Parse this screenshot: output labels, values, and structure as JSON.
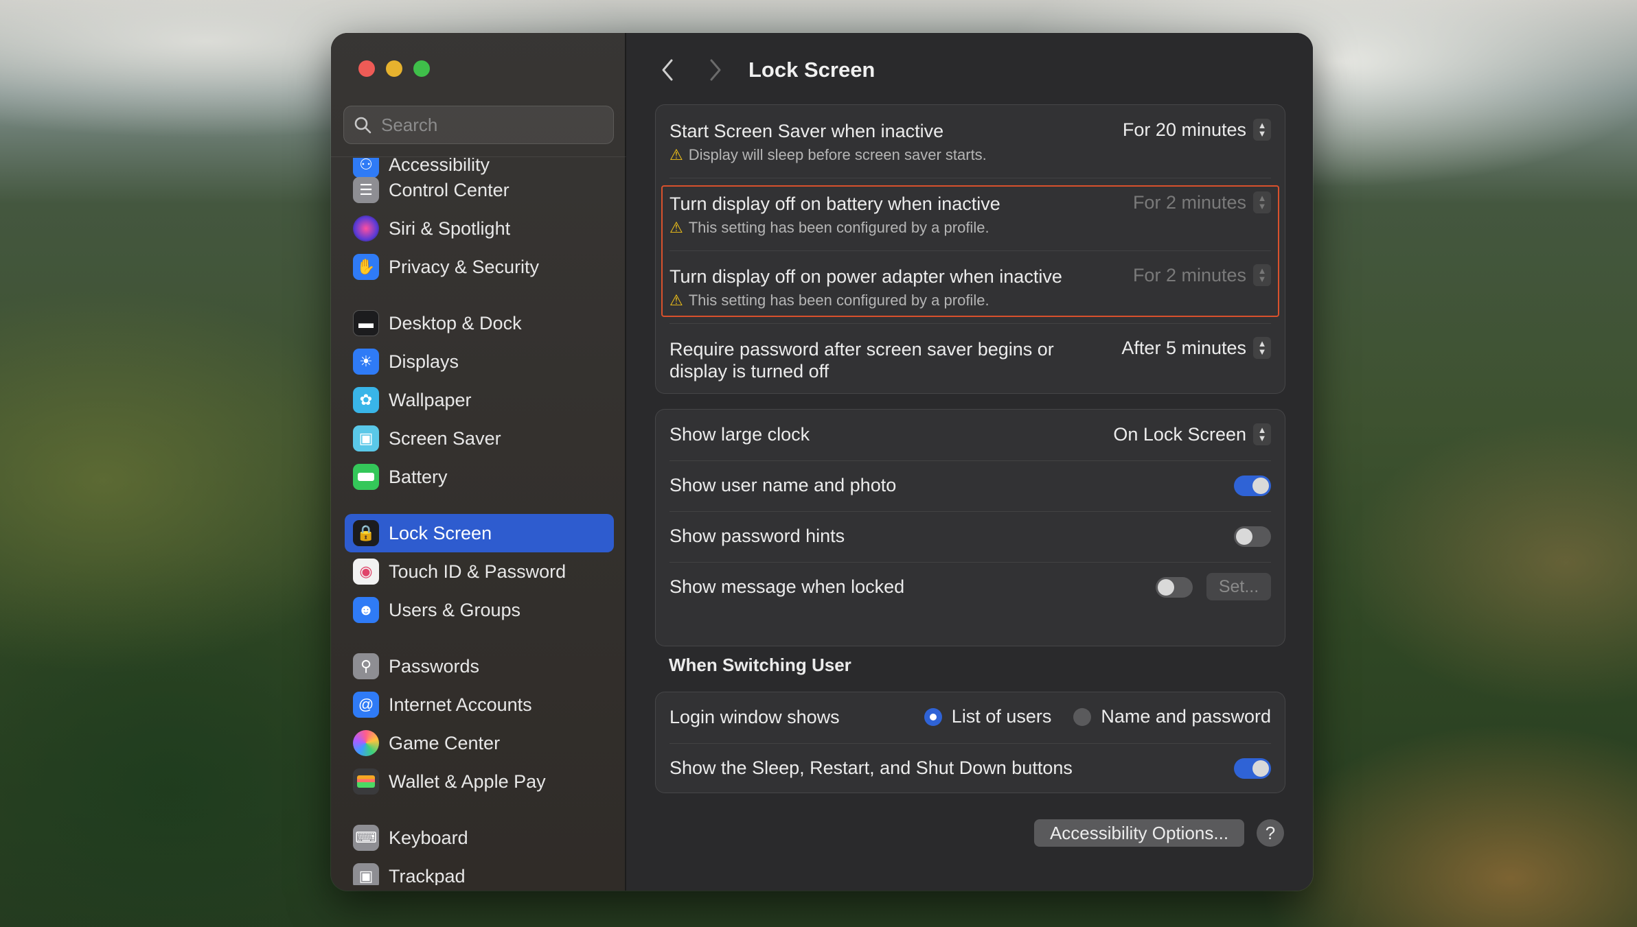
{
  "window": {
    "traffic_lights": [
      "close",
      "minimize",
      "zoom"
    ]
  },
  "sidebar": {
    "search_placeholder": "Search",
    "items": [
      {
        "label": "Accessibility",
        "icon": "accessibility-icon",
        "color": "#2f7bf6"
      },
      {
        "label": "Control Center",
        "icon": "control-center-icon",
        "color": "#8e8e93"
      },
      {
        "label": "Siri & Spotlight",
        "icon": "siri-icon",
        "color": "#7a4bd6"
      },
      {
        "label": "Privacy & Security",
        "icon": "hand-icon",
        "color": "#2f7bf6"
      },
      {
        "label": "Desktop & Dock",
        "icon": "dock-icon",
        "color": "#1c1c1e"
      },
      {
        "label": "Displays",
        "icon": "sun-icon",
        "color": "#2f7bf6"
      },
      {
        "label": "Wallpaper",
        "icon": "flower-icon",
        "color": "#39b5e8"
      },
      {
        "label": "Screen Saver",
        "icon": "screen-saver-icon",
        "color": "#5ac8e8"
      },
      {
        "label": "Battery",
        "icon": "battery-icon",
        "color": "#34c759"
      },
      {
        "label": "Lock Screen",
        "icon": "lock-icon",
        "color": "#1c1c1e"
      },
      {
        "label": "Touch ID & Password",
        "icon": "fingerprint-icon",
        "color": "#f2f2f2"
      },
      {
        "label": "Users & Groups",
        "icon": "users-icon",
        "color": "#2f7bf6"
      },
      {
        "label": "Passwords",
        "icon": "key-icon",
        "color": "#8e8e93"
      },
      {
        "label": "Internet Accounts",
        "icon": "at-icon",
        "color": "#2f7bf6"
      },
      {
        "label": "Game Center",
        "icon": "game-center-icon",
        "color": "#ff6b8a"
      },
      {
        "label": "Wallet & Apple Pay",
        "icon": "wallet-icon",
        "color": "#3a3a3c"
      },
      {
        "label": "Keyboard",
        "icon": "keyboard-icon",
        "color": "#8e8e93"
      },
      {
        "label": "Trackpad",
        "icon": "trackpad-icon",
        "color": "#8e8e93"
      }
    ],
    "selected": "Lock Screen"
  },
  "header": {
    "back_icon": "chevron-left-icon",
    "forward_icon": "chevron-right-icon",
    "title": "Lock Screen"
  },
  "group1": {
    "rows": [
      {
        "title": "Start Screen Saver when inactive",
        "sub": "Display will sleep before screen saver starts.",
        "value": "For 20 minutes",
        "enabled": true
      },
      {
        "title": "Turn display off on battery when inactive",
        "sub": "This setting has been configured by a profile.",
        "value": "For 2 minutes",
        "enabled": false
      },
      {
        "title": "Turn display off on power adapter when inactive",
        "sub": "This setting has been configured by a profile.",
        "value": "For 2 minutes",
        "enabled": false
      },
      {
        "title_line1": "Require password after screen saver begins or",
        "title_line2": "display is turned off",
        "value": "After 5 minutes",
        "enabled": true
      }
    ]
  },
  "group2": {
    "large_clock": {
      "label": "Show large clock",
      "value": "On Lock Screen"
    },
    "user_photo": {
      "label": "Show user name and photo",
      "on": true
    },
    "password_hints": {
      "label": "Show password hints",
      "on": false
    },
    "message": {
      "label": "Show message when locked",
      "on": false,
      "button": "Set..."
    }
  },
  "switching": {
    "title": "When Switching User",
    "login_label": "Login window shows",
    "options": [
      "List of users",
      "Name and password"
    ],
    "selected": "List of users",
    "sleep_buttons": {
      "label": "Show the Sleep, Restart, and Shut Down buttons",
      "on": true
    }
  },
  "footer": {
    "accessibility_button": "Accessibility Options...",
    "help": "?"
  },
  "colors": {
    "accent": "#2f63d6",
    "highlight_border": "#d9512c",
    "warning": "#f5c518"
  }
}
